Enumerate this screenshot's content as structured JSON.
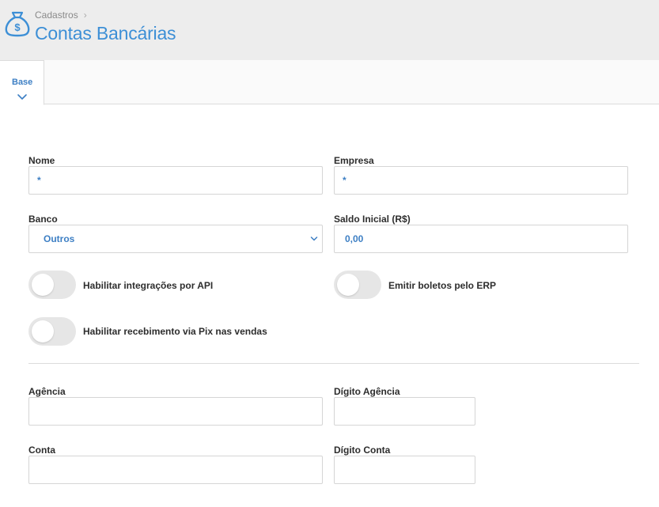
{
  "header": {
    "breadcrumb": "Cadastros",
    "title": "Contas Bancárias",
    "icon": "money-bag-icon"
  },
  "tabs": [
    {
      "label": "Base",
      "active": true
    }
  ],
  "form": {
    "nome": {
      "label": "Nome",
      "value": "*"
    },
    "empresa": {
      "label": "Empresa",
      "value": "*"
    },
    "banco": {
      "label": "Banco",
      "value": "Outros"
    },
    "saldo_inicial": {
      "label": "Saldo Inicial (R$)",
      "value": "0,00"
    },
    "toggle_api": {
      "label": "Habilitar integrações por API",
      "on": false
    },
    "toggle_boletos": {
      "label": "Emitir boletos pelo ERP",
      "on": false
    },
    "toggle_pix": {
      "label": "Habilitar recebimento via Pix nas vendas",
      "on": false
    },
    "agencia": {
      "label": "Agência",
      "value": ""
    },
    "digito_agencia": {
      "label": "Dígito Agência",
      "value": ""
    },
    "conta": {
      "label": "Conta",
      "value": ""
    },
    "digito_conta": {
      "label": "Dígito Conta",
      "value": ""
    }
  },
  "colors": {
    "accent": "#3d8fd6",
    "header_bg": "#ededed"
  }
}
